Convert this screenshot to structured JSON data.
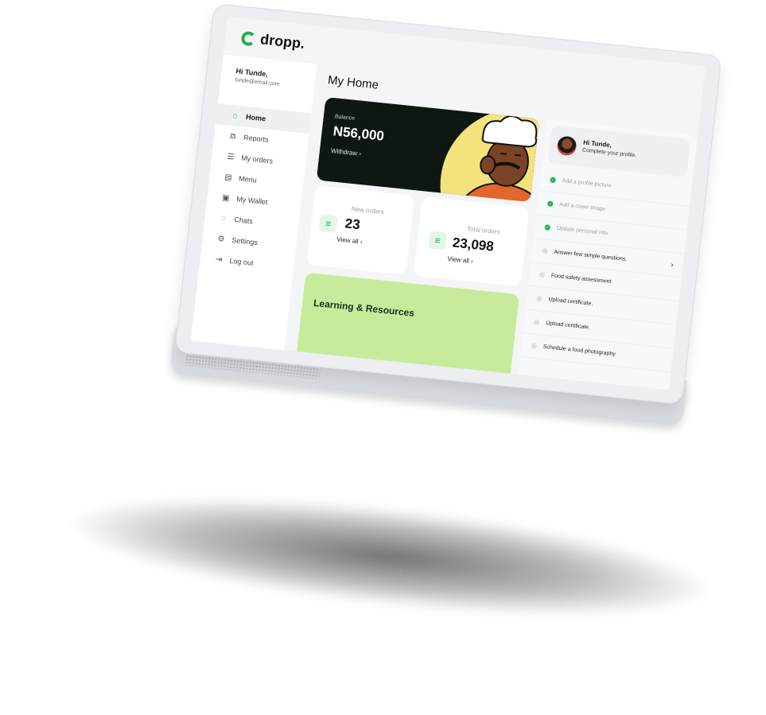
{
  "brand": {
    "name": "dropp.",
    "accent": "#1fb14a",
    "learn_bg": "#c8eb9b",
    "card_dark": "#0f1712"
  },
  "user": {
    "greeting": "Hi Tunde,",
    "email": "tunde@email.com"
  },
  "sidebar": {
    "items": [
      {
        "label": "Home",
        "icon": "home-icon",
        "active": true
      },
      {
        "label": "Reports",
        "icon": "chart-icon"
      },
      {
        "label": "My orders",
        "icon": "orders-icon"
      },
      {
        "label": "Menu",
        "icon": "menu-icon"
      },
      {
        "label": "My Wallet",
        "icon": "wallet-icon"
      },
      {
        "label": "Chats",
        "icon": "chat-icon"
      },
      {
        "label": "Settings",
        "icon": "gear-icon"
      },
      {
        "label": "Log out",
        "icon": "logout-icon"
      }
    ]
  },
  "main": {
    "title": "My Home",
    "balance": {
      "label": "Balance",
      "amount": "N56,000",
      "action": "Withdraw ›"
    },
    "new_orders": {
      "label": "New orders",
      "value": "23",
      "link": "View all ›"
    },
    "total_orders": {
      "label": "Total orders",
      "value": "23,098",
      "link": "View all ›"
    },
    "learning": {
      "title": "Learning & Resources"
    }
  },
  "profile": {
    "title": "Hi Tunde,",
    "subtitle": "Complete your profile.",
    "tasks": [
      {
        "label": "Add a profile picture",
        "done": true
      },
      {
        "label": "Add a cover image",
        "done": true
      },
      {
        "label": "Update personal info",
        "done": true
      },
      {
        "label": "Answer few simple questions.",
        "done": false,
        "chevron": "›"
      },
      {
        "label": "Food safety assessment",
        "done": false
      },
      {
        "label": "Upload certificate.",
        "done": false
      },
      {
        "label": "Upload certificate.",
        "done": false
      },
      {
        "label": "Schedule a food photography",
        "done": false
      }
    ]
  }
}
